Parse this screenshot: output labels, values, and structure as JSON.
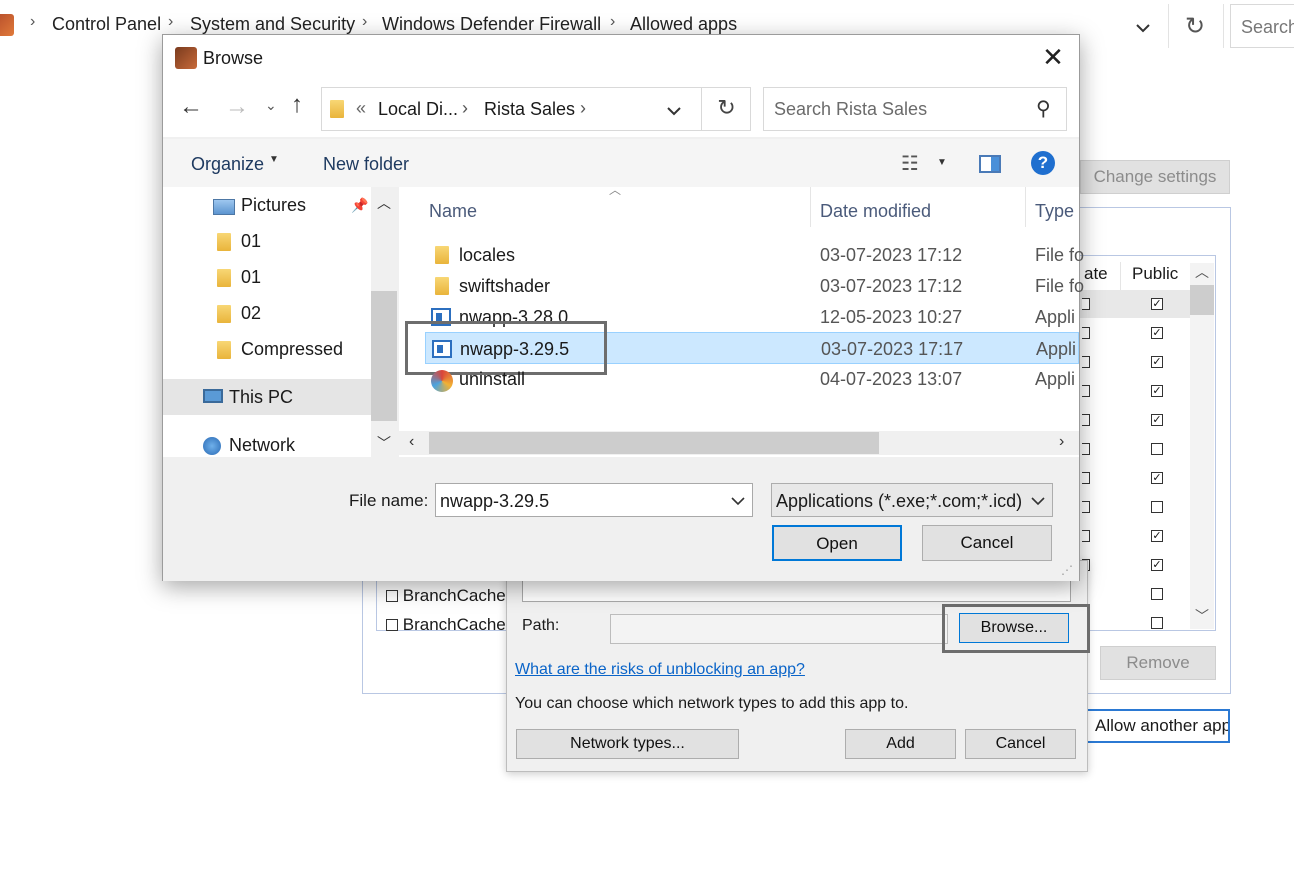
{
  "background": {
    "breadcrumbs": [
      "Control Panel",
      "System and Security",
      "Windows Defender Firewall",
      "Allowed apps"
    ],
    "search_placeholder": "Search",
    "change_settings": "Change settings",
    "columns": {
      "private_partial": "ate",
      "public": "Public"
    },
    "list_rows": [
      "BranchCache -",
      "BranchCache -"
    ],
    "public_checks": [
      true,
      true,
      true,
      true,
      true,
      false,
      true,
      false,
      true,
      true,
      false,
      false
    ],
    "remove_label": "Remove",
    "allow_another_label": "Allow another app..."
  },
  "add_app": {
    "path_label": "Path:",
    "path_value": "",
    "browse_label": "Browse...",
    "risk_link": "What are the risks of unblocking an app?",
    "choose_text": "You can choose which network types to add this app to.",
    "network_types_label": "Network types...",
    "add_label": "Add",
    "cancel_label": "Cancel"
  },
  "browse": {
    "title": "Browse",
    "path_prefix": "«",
    "path": [
      "Local Di...",
      "Rista Sales"
    ],
    "search_placeholder": "Search Rista Sales",
    "organize_label": "Organize",
    "new_folder_label": "New folder",
    "nav_items": [
      {
        "label": "Pictures",
        "icon": "pictures-icon",
        "pinned": true
      },
      {
        "label": "01",
        "icon": "folder-icon"
      },
      {
        "label": "01",
        "icon": "folder-icon"
      },
      {
        "label": "02",
        "icon": "folder-icon"
      },
      {
        "label": "Compressed",
        "icon": "folder-icon"
      },
      {
        "label": "This PC",
        "icon": "pc-icon",
        "selected": true
      },
      {
        "label": "Network",
        "icon": "network-icon"
      }
    ],
    "columns": [
      "Name",
      "Date modified",
      "Type"
    ],
    "files": [
      {
        "name": "locales",
        "date": "03-07-2023 17:12",
        "type": "File fo",
        "icon": "folder-icon"
      },
      {
        "name": "swiftshader",
        "date": "03-07-2023 17:12",
        "type": "File fo",
        "icon": "folder-icon"
      },
      {
        "name": "nwapp-3.28.0",
        "date": "12-05-2023 10:27",
        "type": "Appli",
        "icon": "application-icon"
      },
      {
        "name": "nwapp-3.29.5",
        "date": "03-07-2023 17:17",
        "type": "Appli",
        "icon": "application-icon",
        "selected": true
      },
      {
        "name": "uninstall",
        "date": "04-07-2023 13:07",
        "type": "Appli",
        "icon": "uninstall-icon"
      }
    ],
    "file_name_label": "File name:",
    "file_name_value": "nwapp-3.29.5",
    "file_type_value": "Applications (*.exe;*.com;*.icd)",
    "open_label": "Open",
    "cancel_label": "Cancel"
  }
}
